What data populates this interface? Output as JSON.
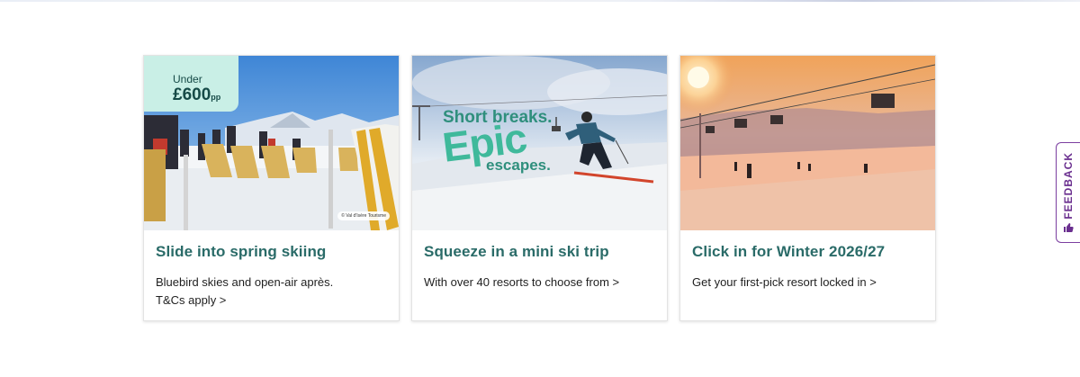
{
  "cards": [
    {
      "title": "Slide into spring skiing",
      "description": "Bluebird skies and open-air après.",
      "link": "T&Cs apply >",
      "badge": {
        "label": "Under",
        "price": "£600",
        "suffix": "pp"
      },
      "credit": "© Val d'Isère Tourisme"
    },
    {
      "title": "Squeeze in a mini ski trip",
      "description": "With over 40 resorts to choose from >",
      "promo": {
        "line1": "Short breaks.",
        "line2": "Epic",
        "line3": "escapes."
      }
    },
    {
      "title": "Click in for Winter 2026/27",
      "description": "Get your first-pick resort locked in >"
    }
  ],
  "feedback": {
    "label": "FEEDBACK",
    "icon": "thumbs-up-icon"
  },
  "colors": {
    "title": "#2a6b68",
    "badge_bg": "#c9efe6",
    "feedback": "#6a2f8f"
  }
}
